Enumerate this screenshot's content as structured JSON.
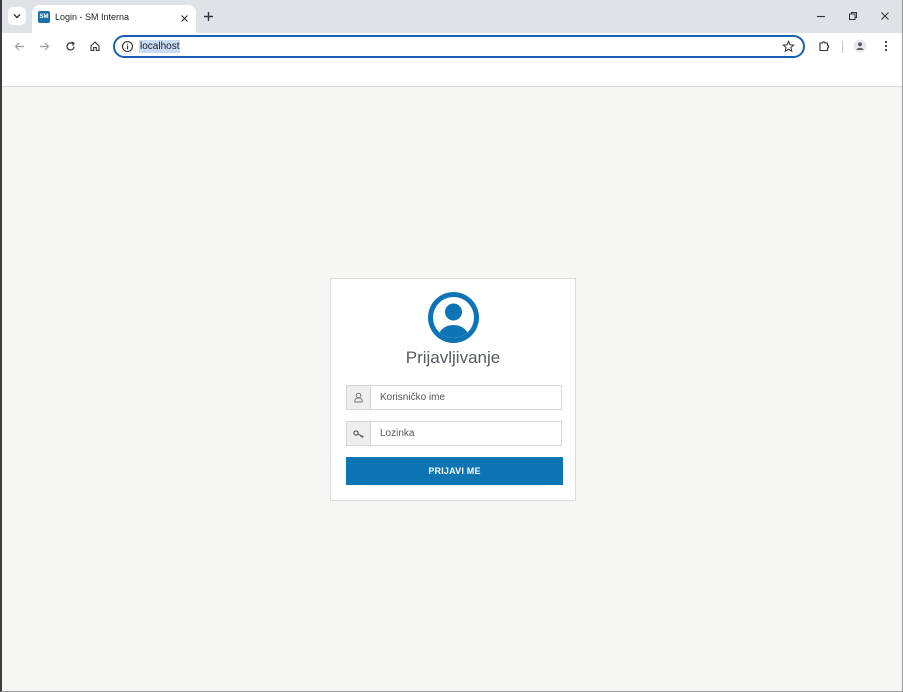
{
  "browser": {
    "tab": {
      "favicon_text": "SM",
      "title": "Login - SM Interna"
    },
    "address_bar": {
      "url": "localhost"
    }
  },
  "login": {
    "heading": "Prijavljivanje",
    "username_placeholder": "Korisničko ime",
    "password_placeholder": "Lozinka",
    "submit_label": "PRIJAVI ME"
  },
  "colors": {
    "accent": "#0e75b5",
    "page_background": "#f6f6f5",
    "omnibox_border": "#1a5fb4"
  }
}
